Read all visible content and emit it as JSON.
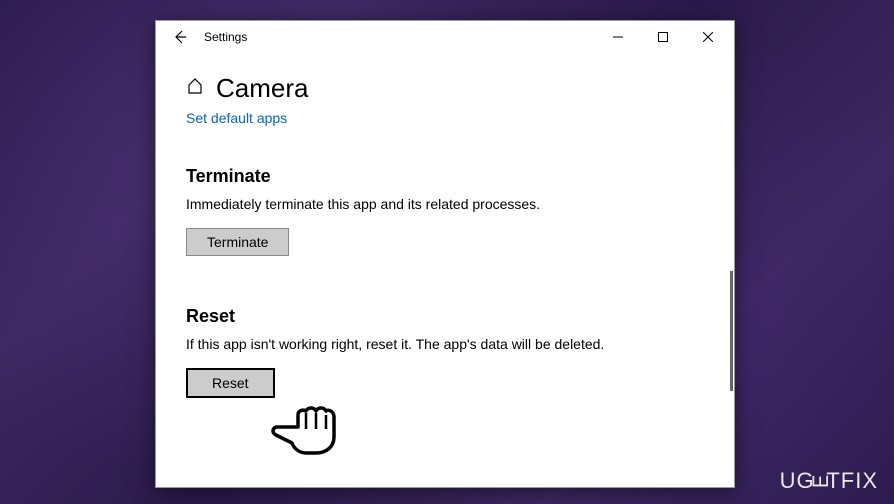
{
  "titlebar": {
    "title": "Settings"
  },
  "page": {
    "title": "Camera",
    "default_apps_link": "Set default apps"
  },
  "terminate": {
    "heading": "Terminate",
    "description": "Immediately terminate this app and its related processes.",
    "button_label": "Terminate"
  },
  "reset": {
    "heading": "Reset",
    "description": "If this app isn't working right, reset it. The app's data will be deleted.",
    "button_label": "Reset"
  },
  "watermark": {
    "text_prefix": "UG",
    "text_e": "E",
    "text_suffix": "TFIX"
  }
}
